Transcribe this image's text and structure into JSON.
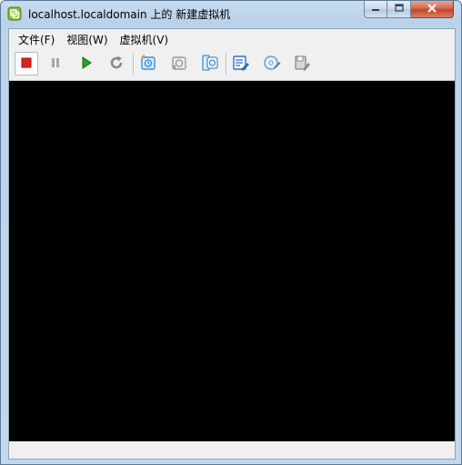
{
  "window": {
    "title": "localhost.localdomain 上的 新建虚拟机",
    "icon": "vsphere-console-icon"
  },
  "caption_buttons": [
    {
      "name": "minimize-button",
      "icon": "minimize-icon"
    },
    {
      "name": "maximize-button",
      "icon": "maximize-icon"
    },
    {
      "name": "close-button",
      "icon": "close-icon"
    }
  ],
  "menubar": {
    "items": [
      {
        "label": "文件(F)"
      },
      {
        "label": "视图(W)"
      },
      {
        "label": "虚拟机(V)"
      }
    ]
  },
  "toolbar": {
    "buttons": [
      {
        "name": "power-off-button",
        "icon": "stop-icon",
        "color": "#e02020"
      },
      {
        "name": "suspend-button",
        "icon": "pause-icon",
        "color": "#9a9a9a"
      },
      {
        "name": "power-on-button",
        "icon": "play-icon",
        "color": "#1fa51f"
      },
      {
        "name": "reset-button",
        "icon": "refresh-icon",
        "color": "#8a8a8a"
      },
      {
        "name": "take-snapshot-button",
        "icon": "snapshot-icon",
        "color": "#3c8fd6"
      },
      {
        "name": "revert-snapshot-button",
        "icon": "revert-snapshot-icon",
        "color": "#9a9a9a"
      },
      {
        "name": "snapshot-manager-button",
        "icon": "snapshot-manager-icon",
        "color": "#3c8fd6"
      },
      {
        "name": "edit-settings-button",
        "icon": "edit-settings-icon",
        "color": "#2f6fbf"
      },
      {
        "name": "cd-dvd-button",
        "icon": "disc-icon",
        "color": "#5a9ad8"
      },
      {
        "name": "floppy-button",
        "icon": "floppy-tools-icon",
        "color": "#8a8a8a"
      }
    ]
  },
  "colors": {
    "console_background": "#000000",
    "title_bar": "#b9d1ea",
    "client_background": "#f0f0f0"
  }
}
